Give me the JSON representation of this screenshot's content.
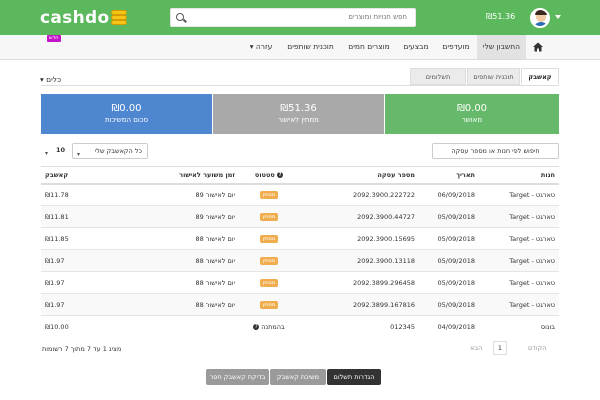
{
  "header": {
    "logo": "cashdo",
    "search_placeholder": "חפש חנויות ומוצרים",
    "balance": "₪51.36"
  },
  "nav": {
    "items": [
      "החשבון שלי",
      "מועדפים",
      "מבצעים",
      "מוצרים חמים",
      "תוכנית שותפים",
      "עזרה"
    ],
    "categories": "כלים",
    "new_badge": "חדש"
  },
  "tabs": [
    "קאשבק",
    "תוכנית שותפים",
    "תשלומים"
  ],
  "boxes": [
    {
      "amount": "₪0.00",
      "label": "מאושר",
      "color": "#66b96a"
    },
    {
      "amount": "₪51.36",
      "label": "ממתין לאישור",
      "color": "#a9a9a9"
    },
    {
      "amount": "₪0.00",
      "label": "סכום המשיכות",
      "color": "#4e86d0"
    }
  ],
  "controls": {
    "search_button": "חיפוש לפי חנות או מספר עסקה",
    "filter_select": "כל הקאשבק שלי",
    "page_size": "10"
  },
  "table": {
    "headers": [
      "חנות",
      "תאריך",
      "מספר עסקה",
      "סטטוס",
      "זמן משוער לאישור",
      "קאשבק"
    ],
    "rows": [
      {
        "store": "Target - טארגט",
        "date": "06/09/2018",
        "txn": "2092.3900.222722",
        "status": "ממתין",
        "time": "89 יום לאישור",
        "cash": "₪11.78"
      },
      {
        "store": "Target - טארגט",
        "date": "05/09/2018",
        "txn": "2092.3900.44727",
        "status": "ממתין",
        "time": "89 יום לאישור",
        "cash": "₪11.81"
      },
      {
        "store": "Target - טארגט",
        "date": "05/09/2018",
        "txn": "2092.3900.15695",
        "status": "ממתין",
        "time": "88 יום לאישור",
        "cash": "₪11.85"
      },
      {
        "store": "Target - טארגט",
        "date": "05/09/2018",
        "txn": "2092.3900.13118",
        "status": "ממתין",
        "time": "88 יום לאישור",
        "cash": "₪1.97"
      },
      {
        "store": "Target - טארגט",
        "date": "05/09/2018",
        "txn": "2092.3899.296458",
        "status": "ממתין",
        "time": "88 יום לאישור",
        "cash": "₪1.97"
      },
      {
        "store": "Target - טארגט",
        "date": "05/09/2018",
        "txn": "2092.3899.167816",
        "status": "ממתין",
        "time": "88 יום לאישור",
        "cash": "₪1.97"
      },
      {
        "store": "בונוס",
        "date": "04/09/2018",
        "txn": "012345",
        "status": "בהמתנה",
        "time": "",
        "cash": "₪10.00"
      }
    ]
  },
  "footer": {
    "summary": "מציג 1 עד 7 מתוך 7 רשומות",
    "prev": "הקודם",
    "page": "1",
    "next": "הבא"
  },
  "buttons": [
    "הגדרות תשלום",
    "משיכת קאשבק",
    "בדיקת קאשבק חסר"
  ]
}
